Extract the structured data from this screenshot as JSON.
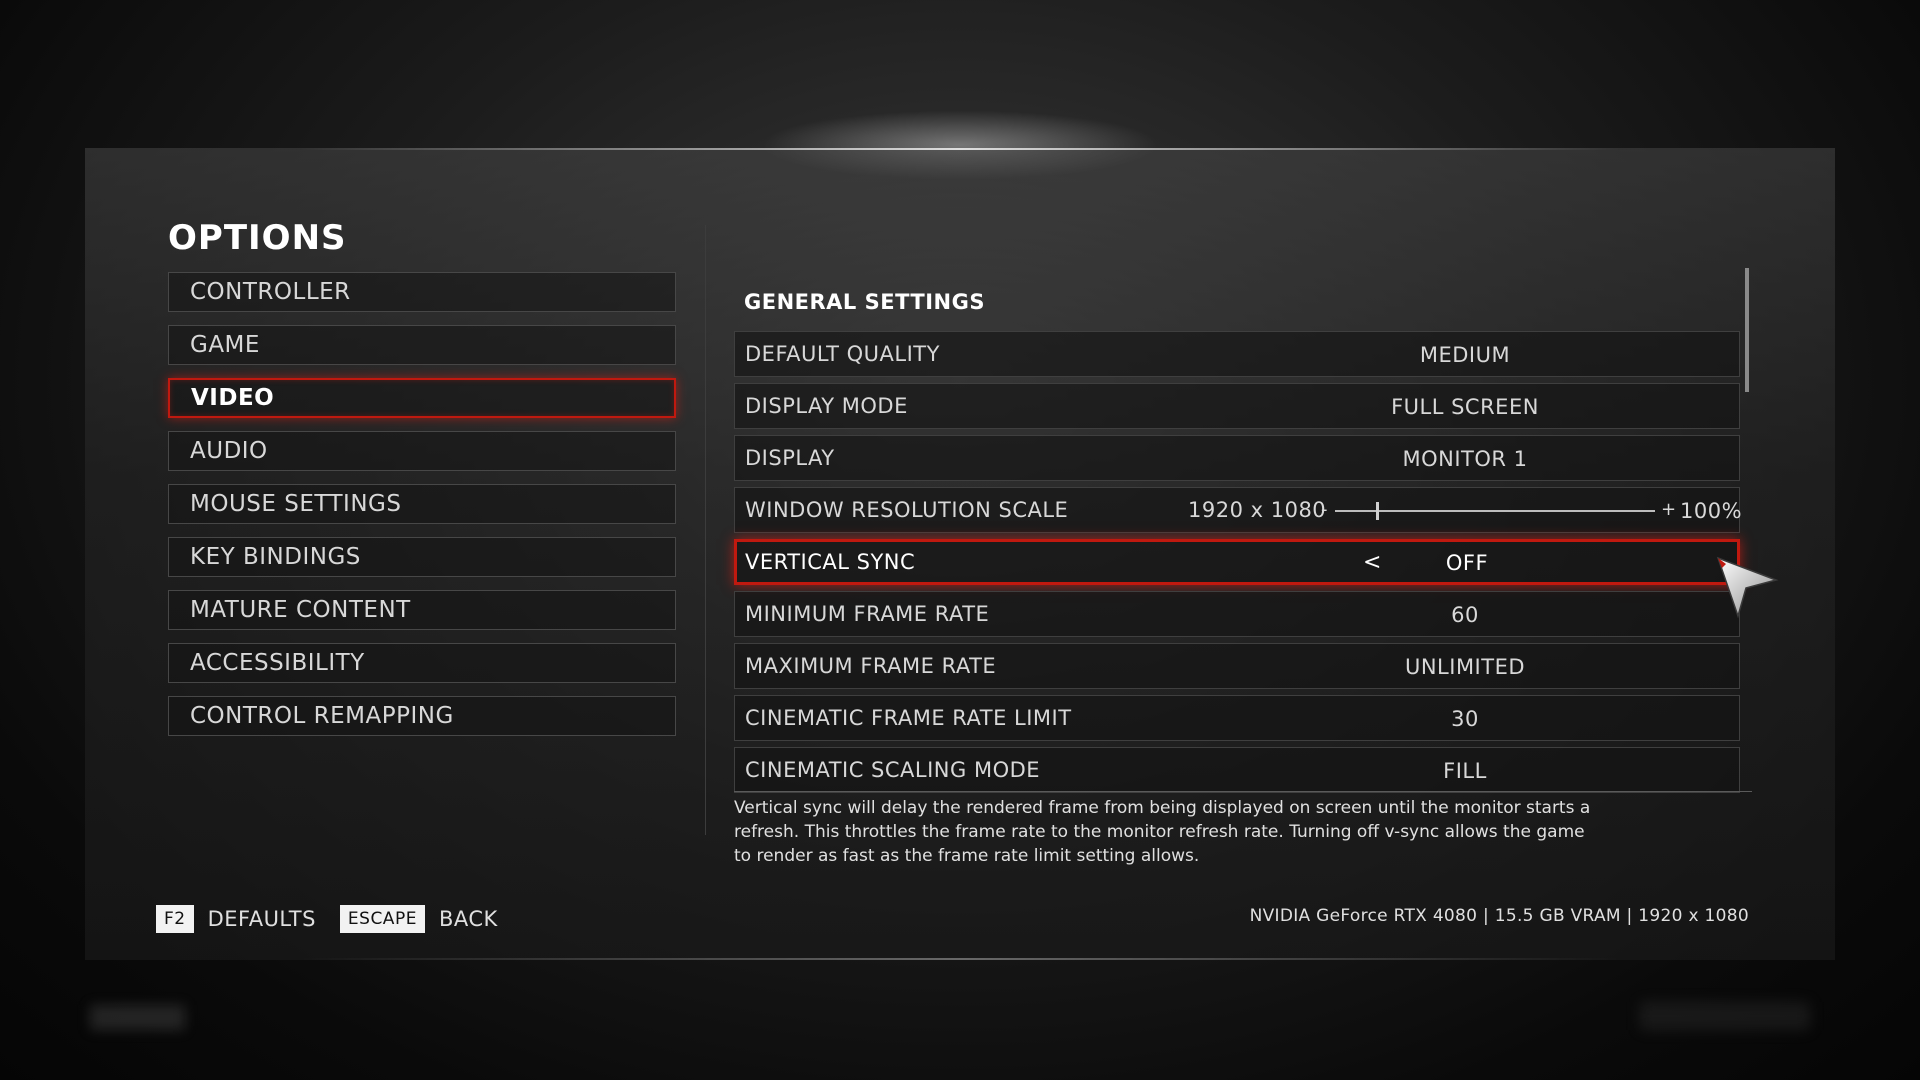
{
  "title": "OPTIONS",
  "menu": {
    "items": [
      {
        "label": "CONTROLLER"
      },
      {
        "label": "GAME"
      },
      {
        "label": "VIDEO"
      },
      {
        "label": "AUDIO"
      },
      {
        "label": "MOUSE SETTINGS"
      },
      {
        "label": "KEY BINDINGS"
      },
      {
        "label": "MATURE CONTENT"
      },
      {
        "label": "ACCESSIBILITY"
      },
      {
        "label": "CONTROL REMAPPING"
      }
    ],
    "active": "VIDEO"
  },
  "section_title": "GENERAL SETTINGS",
  "settings": {
    "default_quality": {
      "label": "DEFAULT QUALITY",
      "value": "MEDIUM"
    },
    "display_mode": {
      "label": "DISPLAY MODE",
      "value": "FULL SCREEN"
    },
    "display": {
      "label": "DISPLAY",
      "value": "MONITOR 1"
    },
    "window_resolution_scale": {
      "label": "WINDOW RESOLUTION SCALE",
      "resolution": "1920 x 1080",
      "minus": "-",
      "plus": "+",
      "percent": "100%",
      "slider_fraction": 0.13
    },
    "vertical_sync": {
      "label": "VERTICAL SYNC",
      "value": "OFF",
      "left_arrow": "<"
    },
    "min_frame_rate": {
      "label": "MINIMUM FRAME RATE",
      "value": "60"
    },
    "max_frame_rate": {
      "label": "MAXIMUM FRAME RATE",
      "value": "UNLIMITED"
    },
    "cinematic_frame_rate_limit": {
      "label": "CINEMATIC FRAME RATE LIMIT",
      "value": "30"
    },
    "cinematic_scaling_mode": {
      "label": "CINEMATIC SCALING MODE",
      "value": "FILL"
    }
  },
  "description": "Vertical sync will delay the rendered frame from being displayed on screen until the monitor starts a refresh. This throttles the frame rate to the monitor refresh rate. Turning off v-sync allows the game to render as fast as the frame rate limit setting allows.",
  "footer": {
    "defaults_key": "F2",
    "defaults_label": "DEFAULTS",
    "back_key": "ESCAPE",
    "back_label": "BACK"
  },
  "system_info": "NVIDIA GeForce RTX 4080 | 15.5 GB VRAM | 1920 x 1080",
  "colors": {
    "accent": "#c0190f",
    "text": "#e6e6e6",
    "background": "#1c1c1c"
  },
  "icons": {
    "cursor": "mouse-pointer-icon",
    "arrow": "chevron-left-icon"
  }
}
